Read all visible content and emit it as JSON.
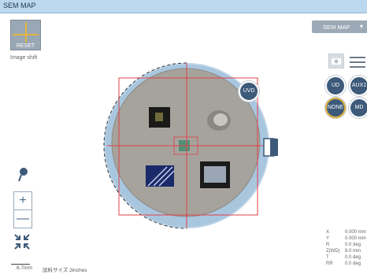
{
  "window": {
    "title": "SEM MAP"
  },
  "controls": {
    "reset_label": "RESET",
    "image_shift_label": "Image shift",
    "map_mode": "SEM MAP"
  },
  "detectors": {
    "uvd": "UVD",
    "ud": "UD",
    "aux1": "AUX1",
    "none": "NONE",
    "md": "MD",
    "selected": "NONE"
  },
  "zoom": {
    "plus": "+",
    "minus": "—"
  },
  "scale": {
    "bar_label": "6.7mm",
    "sample_size": "試料サイズ 2inches"
  },
  "coords": [
    {
      "k": "X",
      "v": "0.000 mm"
    },
    {
      "k": "Y",
      "v": "0.000 mm"
    },
    {
      "k": "R",
      "v": "0.0 deg"
    },
    {
      "k": "Z(WD)",
      "v": "8.0 mm"
    },
    {
      "k": "T",
      "v": "0.0 deg"
    },
    {
      "k": "RR",
      "v": "0.0 deg"
    }
  ],
  "colors": {
    "accent": "#e0b33e",
    "titlebar": "#bcd8ee",
    "crosshair": "#e0404a",
    "detector_btn": "#3d5a7a"
  }
}
